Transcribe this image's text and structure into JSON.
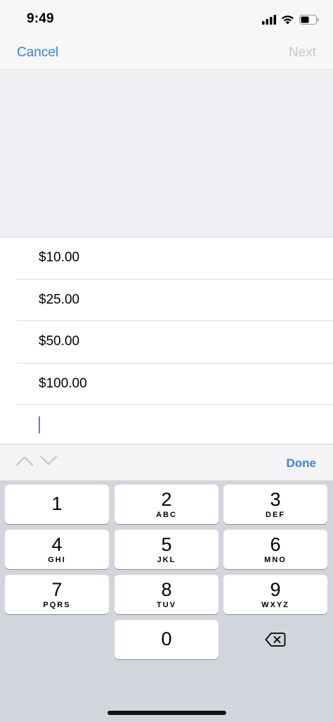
{
  "status": {
    "time": "9:49"
  },
  "nav": {
    "cancel_label": "Cancel",
    "next_label": "Next"
  },
  "options": [
    {
      "label": "$10.00"
    },
    {
      "label": "$25.00"
    },
    {
      "label": "$50.00"
    },
    {
      "label": "$100.00"
    }
  ],
  "accessory": {
    "done_label": "Done"
  },
  "keypad": {
    "keys": [
      {
        "num": "1",
        "letters": ""
      },
      {
        "num": "2",
        "letters": "ABC"
      },
      {
        "num": "3",
        "letters": "DEF"
      },
      {
        "num": "4",
        "letters": "GHI"
      },
      {
        "num": "5",
        "letters": "JKL"
      },
      {
        "num": "6",
        "letters": "MNO"
      },
      {
        "num": "7",
        "letters": "PQRS"
      },
      {
        "num": "8",
        "letters": "TUV"
      },
      {
        "num": "9",
        "letters": "WXYZ"
      },
      {
        "num": "0",
        "letters": ""
      }
    ]
  },
  "colors": {
    "accent": "#3b82e0",
    "disabled": "#c7c7cc",
    "keyboard_bg": "#d2d5db"
  }
}
